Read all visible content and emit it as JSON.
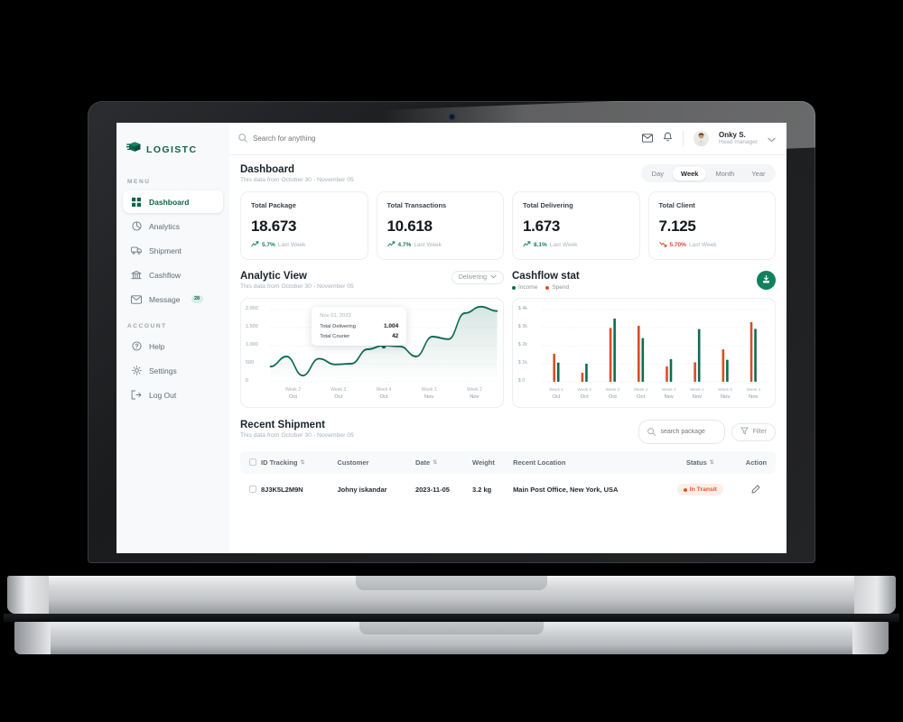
{
  "brand": {
    "name": "LOGISTC",
    "icon": "package-logo-icon"
  },
  "sidebar": {
    "menu_label": "MENU",
    "account_label": "ACCOUNT",
    "menu_items": [
      {
        "label": "Dashboard",
        "icon": "grid-icon",
        "active": true
      },
      {
        "label": "Analytics",
        "icon": "pie-chart-icon",
        "active": false
      },
      {
        "label": "Shipment",
        "icon": "truck-icon",
        "active": false
      },
      {
        "label": "Cashflow",
        "icon": "bank-icon",
        "active": false
      },
      {
        "label": "Message",
        "icon": "envelope-icon",
        "active": false,
        "badge": "28"
      }
    ],
    "account_items": [
      {
        "label": "Help",
        "icon": "question-circle-icon"
      },
      {
        "label": "Settings",
        "icon": "gear-icon"
      },
      {
        "label": "Log Out",
        "icon": "logout-icon"
      }
    ]
  },
  "topbar": {
    "search_placeholder": "Search for anything",
    "search_value": "",
    "mail_icon": "envelope-icon",
    "bell_icon": "bell-icon",
    "user_name": "Onky S.",
    "user_role": "Head manager",
    "chevron_icon": "chevron-down-icon"
  },
  "dashboard": {
    "title": "Dashboard",
    "subtitle": "This data from October 30 - November 05",
    "range_tabs": [
      {
        "label": "Day",
        "active": false
      },
      {
        "label": "Week",
        "active": true
      },
      {
        "label": "Month",
        "active": false
      },
      {
        "label": "Year",
        "active": false
      }
    ],
    "cards": [
      {
        "title": "Total Package",
        "value": "18.673",
        "delta": "5.7%",
        "direction": "up",
        "period": "Last Week"
      },
      {
        "title": "Total Transactions",
        "value": "10.618",
        "delta": "4.7%",
        "direction": "up",
        "period": "Last Week"
      },
      {
        "title": "Total Delivering",
        "value": "1.673",
        "delta": "8.1%",
        "direction": "up",
        "period": "Last Week"
      },
      {
        "title": "Total Client",
        "value": "7.125",
        "delta": "5.70%",
        "direction": "down",
        "period": "Last Week"
      }
    ]
  },
  "analytic": {
    "title": "Analytic View",
    "subtitle": "This data from October 30 - November 05",
    "selector": {
      "label": "Delivering",
      "icon": "chevron-down-icon"
    },
    "tooltip": {
      "date": "Nov 01, 2023",
      "rows": [
        {
          "label": "Total Delivering",
          "value": "1.004"
        },
        {
          "label": "Total Courier",
          "value": "42"
        }
      ]
    }
  },
  "cashflow": {
    "title": "Cashflow stat",
    "legend": [
      {
        "label": "Income",
        "color": "#0f6b52"
      },
      {
        "label": "Spend",
        "color": "#d94f21"
      }
    ],
    "download_icon": "download-icon"
  },
  "shipment": {
    "title": "Recent Shipment",
    "subtitle": "This data from October 30 - November 05",
    "search_placeholder": "search package",
    "search_value": "",
    "filter_label": "Filter",
    "filter_icon": "funnel-icon",
    "search_icon": "search-icon",
    "columns": [
      {
        "label": "ID Tracking",
        "sortable": true
      },
      {
        "label": "Customer",
        "sortable": false
      },
      {
        "label": "Date",
        "sortable": true
      },
      {
        "label": "Weight",
        "sortable": false
      },
      {
        "label": "Recent Location",
        "sortable": false
      },
      {
        "label": "Status",
        "sortable": true
      },
      {
        "label": "Action",
        "sortable": false
      }
    ],
    "rows": [
      {
        "id_tracking": "8J3K5L2M9N",
        "customer": "Johny iskandar",
        "date": "2023-11-05",
        "weight": "3.2 kg",
        "location": "Main Post Office, New York, USA",
        "status": "In Transit",
        "action_icon": "pencil-icon"
      }
    ]
  },
  "chart_data": [
    {
      "type": "line",
      "title": "Analytic View",
      "xlabel": "",
      "ylabel": "",
      "ylim": [
        0,
        2000
      ],
      "yticks": [
        "0",
        "500",
        "1.000",
        "1.500",
        "2.000"
      ],
      "categories": [
        "Week 2\nOct",
        "Week 3\nOct",
        "Week 4\nOct",
        "Week 1\nNov",
        "Week 2\nNov"
      ],
      "tick_labels_top": [
        "Week 2",
        "Week 3",
        "Week 4",
        "Week 1",
        "Week 2"
      ],
      "tick_labels_bottom": [
        "Oct",
        "Oct",
        "Oct",
        "Nov",
        "Nov"
      ],
      "grid": true,
      "series": [
        {
          "name": "Total Delivering",
          "color": "#0f6b52",
          "values": [
            420,
            700,
            170,
            640,
            480,
            500,
            900,
            1004,
            980,
            700,
            1250,
            1180,
            1900,
            2080,
            1960
          ]
        }
      ],
      "highlight_point": {
        "label": "Nov 01, 2023",
        "value": 1004,
        "secondary": 42
      }
    },
    {
      "type": "bar",
      "title": "Cashflow stat",
      "xlabel": "",
      "ylabel": "",
      "ylim": [
        0,
        4000
      ],
      "yticks": [
        "$ 0",
        "$ 1k",
        "$ 2k",
        "$ 3k",
        "$ 4k"
      ],
      "categories": [
        "Week 1 Oct",
        "Week 2 Oct",
        "Week 3 Oct",
        "Week 4 Oct",
        "Week 1 Nov",
        "Week 2 Nov",
        "Week 3 Nov",
        "Week 4 Nov"
      ],
      "tick_labels_top": [
        "Week 1",
        "Week 2",
        "Week 3",
        "Week 4",
        "Week 1",
        "Week 2",
        "Week 3",
        "Week 4"
      ],
      "tick_labels_bottom": [
        "Oct",
        "Oct",
        "Oct",
        "Oct",
        "Nov",
        "Nov",
        "Nov",
        "Nov"
      ],
      "grid": true,
      "legend_position": "top-left",
      "series": [
        {
          "name": "Spend",
          "color": "#d94f21",
          "values": [
            1550,
            500,
            2980,
            3100,
            850,
            1080,
            1800,
            3300
          ]
        },
        {
          "name": "Income",
          "color": "#0f6b52",
          "values": [
            1060,
            1000,
            3500,
            2420,
            1250,
            2920,
            1220,
            2930
          ]
        }
      ]
    }
  ]
}
